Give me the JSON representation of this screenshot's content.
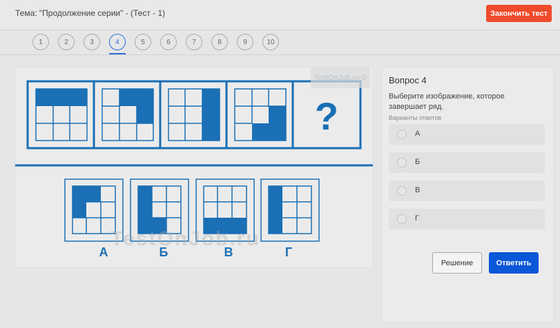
{
  "header": {
    "topic": "Тема: \"Продолжение серии\" - (Тест - 1)",
    "finish_label": "Закончить тест"
  },
  "nav": {
    "items": [
      "1",
      "2",
      "3",
      "4",
      "5",
      "6",
      "7",
      "8",
      "9",
      "10"
    ],
    "active_index": 3
  },
  "puzzle": {
    "question_mark": "?",
    "answer_labels": [
      "А",
      "Б",
      "В",
      "Г"
    ],
    "watermark_top": "TestOnJob.ru ©",
    "watermark_mid": "TestOnJob.ru"
  },
  "question": {
    "title": "Вопрос 4",
    "text": "Выберите изображение, которое завершает ряд.",
    "options_caption": "Варианты ответов",
    "options": [
      "А",
      "Б",
      "В",
      "Г"
    ]
  },
  "buttons": {
    "solution": "Решение",
    "answer": "Ответить"
  },
  "colors": {
    "accent_blue": "#1a6fb5",
    "finish_red": "#ef4b2c",
    "answer_blue": "#0a57d8"
  }
}
